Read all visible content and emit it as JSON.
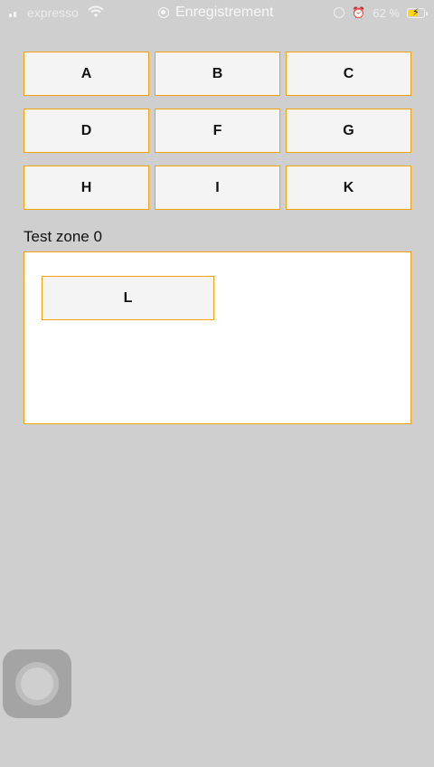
{
  "status_bar": {
    "carrier": "expresso",
    "recording_label": "Enregistrement",
    "battery_text": "62 %",
    "battery_level": 0.62,
    "icons": [
      "signal-icon",
      "wifi-icon",
      "recording-icon",
      "orientation-lock-icon",
      "alarm-icon",
      "battery-icon"
    ]
  },
  "colors": {
    "background": "#cfcfcf",
    "button_border": "#f0a30a",
    "button_fill": "#f4f4f4",
    "zone_fill": "#ffffff"
  },
  "buttons": [
    "A",
    "B",
    "C",
    "D",
    "F",
    "G",
    "H",
    "I",
    "K"
  ],
  "test_zone": {
    "label": "Test zone 0",
    "button_label": "L"
  }
}
